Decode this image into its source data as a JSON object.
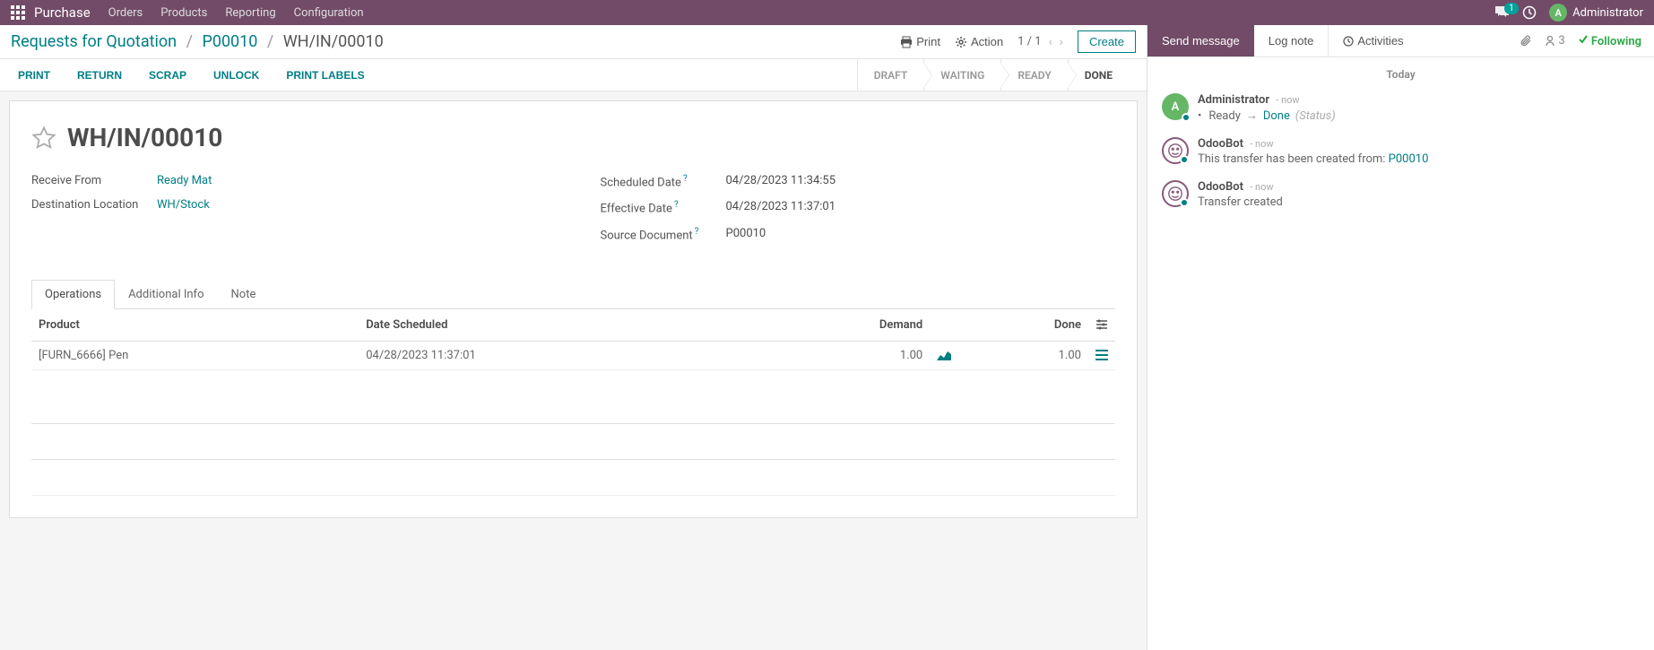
{
  "topbar": {
    "brand": "Purchase",
    "menu": [
      "Orders",
      "Products",
      "Reporting",
      "Configuration"
    ],
    "chat_count": "1",
    "user_initial": "A",
    "user_name": "Administrator"
  },
  "breadcrumb": {
    "root": "Requests for Quotation",
    "mid": "P00010",
    "current": "WH/IN/00010"
  },
  "controls": {
    "print": "Print",
    "action": "Action",
    "pager": "1 / 1",
    "create": "Create"
  },
  "action_buttons": [
    "PRINT",
    "RETURN",
    "SCRAP",
    "UNLOCK",
    "PRINT LABELS"
  ],
  "status_steps": [
    {
      "label": "DRAFT",
      "active": false
    },
    {
      "label": "WAITING",
      "active": false
    },
    {
      "label": "READY",
      "active": false
    },
    {
      "label": "DONE",
      "active": true
    }
  ],
  "form": {
    "title": "WH/IN/00010",
    "fields_left": [
      {
        "label": "Receive From",
        "value": "Ready Mat",
        "link": true
      },
      {
        "label": "Destination Location",
        "value": "WH/Stock",
        "link": true
      }
    ],
    "fields_right": [
      {
        "label": "Scheduled Date",
        "sup": "?",
        "value": "04/28/2023 11:34:55"
      },
      {
        "label": "Effective Date",
        "sup": "?",
        "value": "04/28/2023 11:37:01"
      },
      {
        "label": "Source Document",
        "sup": "?",
        "value": "P00010"
      }
    ]
  },
  "tabs": [
    {
      "label": "Operations",
      "active": true
    },
    {
      "label": "Additional Info",
      "active": false
    },
    {
      "label": "Note",
      "active": false
    }
  ],
  "ops_table": {
    "headers": [
      "Product",
      "Date Scheduled",
      "Demand",
      "Done"
    ],
    "rows": [
      {
        "product": "[FURN_6666] Pen",
        "date": "04/28/2023 11:37:01",
        "demand": "1.00",
        "done": "1.00"
      }
    ]
  },
  "chatter": {
    "send": "Send message",
    "log": "Log note",
    "activities": "Activities",
    "follower_count": "3",
    "following": "Following",
    "today": "Today",
    "messages": [
      {
        "type": "admin",
        "author": "Administrator",
        "time": "now",
        "status_from": "Ready",
        "status_to": "Done",
        "status_suffix": "(Status)"
      },
      {
        "type": "bot",
        "author": "OdooBot",
        "time": "now",
        "body_pre": "This transfer has been created from: ",
        "body_link": "P00010"
      },
      {
        "type": "bot",
        "author": "OdooBot",
        "time": "now",
        "body": "Transfer created"
      }
    ]
  }
}
